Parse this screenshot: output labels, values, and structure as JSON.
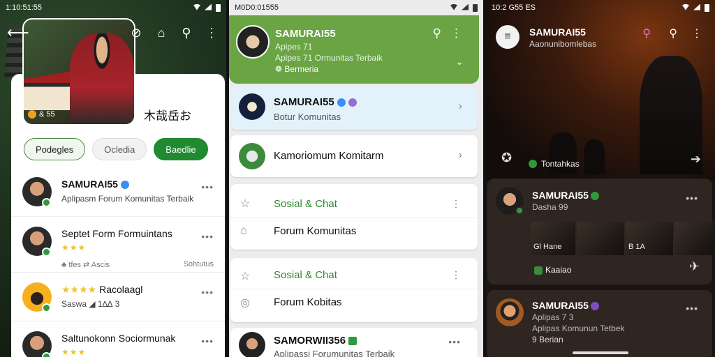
{
  "screen1": {
    "status_time": "1:10:51:55",
    "kanji": "木哉岳お",
    "hero_badge": "& 55",
    "chips": [
      "Podegles",
      "Ocledia",
      "Baedlie"
    ],
    "rows": [
      {
        "title": "SAMURAI55",
        "sub": "Aplipasm Forum Komunitas Terbaik"
      },
      {
        "title": "Septet Form Formuintans",
        "stars": "★★★",
        "meta_left": "♣ tfes  ⇄  Ascis",
        "meta_right": "Sohtutus"
      },
      {
        "title": "Racolaagl",
        "stars_before": "★★★★",
        "sub": "Saswa  ◢  1∆∆ 3"
      },
      {
        "title": "Saltunokonn Sociormunak",
        "stars": "★★★"
      }
    ]
  },
  "screen2": {
    "status_time": "M0D0:01555",
    "header": {
      "title": "SAMURAI55",
      "line1": "Aplpes 71",
      "line2": "Aplpes 71 Ormunitas Terbaik",
      "line3": "❁ Bermeria"
    },
    "cards": [
      {
        "title": "SAMURAI55",
        "sub": "Botur Komunitas"
      },
      {
        "title": "Kamoriomum Komitarm"
      },
      {
        "title": "Sosial & Chat",
        "sub": "Forum Komunitas"
      },
      {
        "title": "Sosial & Chat",
        "sub": "Forum Kobitas"
      },
      {
        "title": "SAMORWII356",
        "sub": "Aplipassi Forumunitas Terbaik"
      }
    ]
  },
  "screen3": {
    "status_time": "10:2 G55 ES",
    "header": {
      "title": "SAMURAI55",
      "sub": "Aaonunibomlebas"
    },
    "mid_label": "Tontahkas",
    "cards": [
      {
        "title": "SAMURAI55",
        "sub": "Dasha 99",
        "thumbs": [
          "Gl Hane",
          "",
          "B 1A",
          ""
        ],
        "tag": "Kaaiao"
      },
      {
        "title": "SAMURAI55",
        "line1": "Aplipas 7 3",
        "line2": "Aplipas Komunun Tetbek",
        "line3": "9 Berian"
      }
    ]
  },
  "colors": {
    "green": "#6aa444",
    "chip_green": "#1f8a2f",
    "star": "#f3c21b",
    "dark_card": "#2f2622"
  }
}
